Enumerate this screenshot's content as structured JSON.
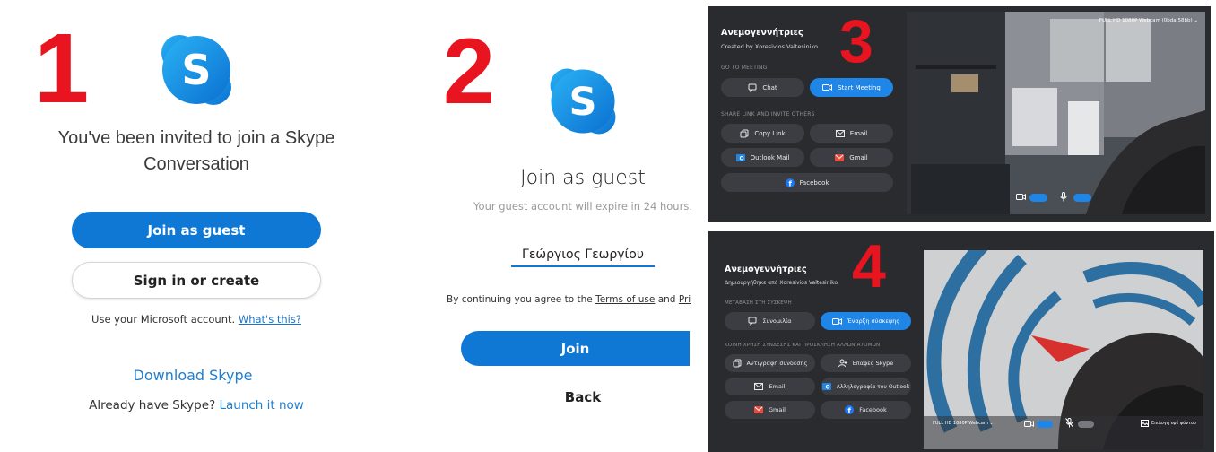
{
  "steps": [
    "1",
    "2",
    "3",
    "4"
  ],
  "panel1": {
    "title": "You've been invited to join a Skype Conversation",
    "join_guest_label": "Join as guest",
    "sign_in_label": "Sign in or create",
    "ms_account_text": "Use your Microsoft account.",
    "whats_this_label": "What's this?",
    "download_label": "Download Skype",
    "already_text": "Already have Skype?",
    "launch_label": "Launch it now"
  },
  "panel2": {
    "title": "Join as guest",
    "subtitle": "Your guest account will expire in 24 hours.",
    "name_value": "Γεώργιος Γεωργίου",
    "terms_prefix": "By continuing you agree to the",
    "terms_link": "Terms of use",
    "terms_and": "and",
    "privacy_link": "Privacy stat",
    "join_label": "Join",
    "back_label": "Back"
  },
  "panel3": {
    "meeting_title": "Ανεμογεννήτριες",
    "created_by": "Created by Xoresivios Valtesiniko",
    "go_to_meeting": "GO TO MEETING",
    "chat_label": "Chat",
    "start_meeting_label": "Start Meeting",
    "share_label": "SHARE LINK AND INVITE OTHERS",
    "copy_link_label": "Copy Link",
    "email_label": "Email",
    "outlook_label": "Outlook Mail",
    "gmail_label": "Gmail",
    "facebook_label": "Facebook",
    "webcam_label": "FULL HD 1080P Webcam (0bda:58bb)"
  },
  "panel4": {
    "meeting_title": "Ανεμογεννήτριες",
    "created_by": "Δημιουργήθηκε από Xoresivios Valtesiniko",
    "go_to_meeting": "ΜΕΤΑΒΑΣΗ ΣΤΗ ΣΥΣΚΕΨΗ",
    "chat_label": "Συνομιλία",
    "start_meeting_label": "Έναρξη σύσκεψης",
    "share_label": "ΚΟΙΝΗ ΧΡΗΣΗ ΣΥΝΔΕΣΗΣ ΚΑΙ ΠΡΟΣΚΛΗΣΗ ΑΛΛΩΝ ΑΤΟΜΩΝ",
    "copy_link_label": "Αντιγραφή σύνδεσης",
    "skype_contacts_label": "Επαφές Skype",
    "email_label": "Email",
    "outlook_label": "Αλληλογραφία του Outlook",
    "gmail_label": "Gmail",
    "facebook_label": "Facebook",
    "webcam_label": "FULL HD 1080P Webcam",
    "background_label": "Επιλογή εφέ φόντου"
  },
  "colors": {
    "skype_blue": "#0f78d4",
    "dark_bg": "#292b2f",
    "dark_button": "#3b3d42",
    "accent_button": "#1f86e8",
    "step_red": "#e8141f"
  }
}
